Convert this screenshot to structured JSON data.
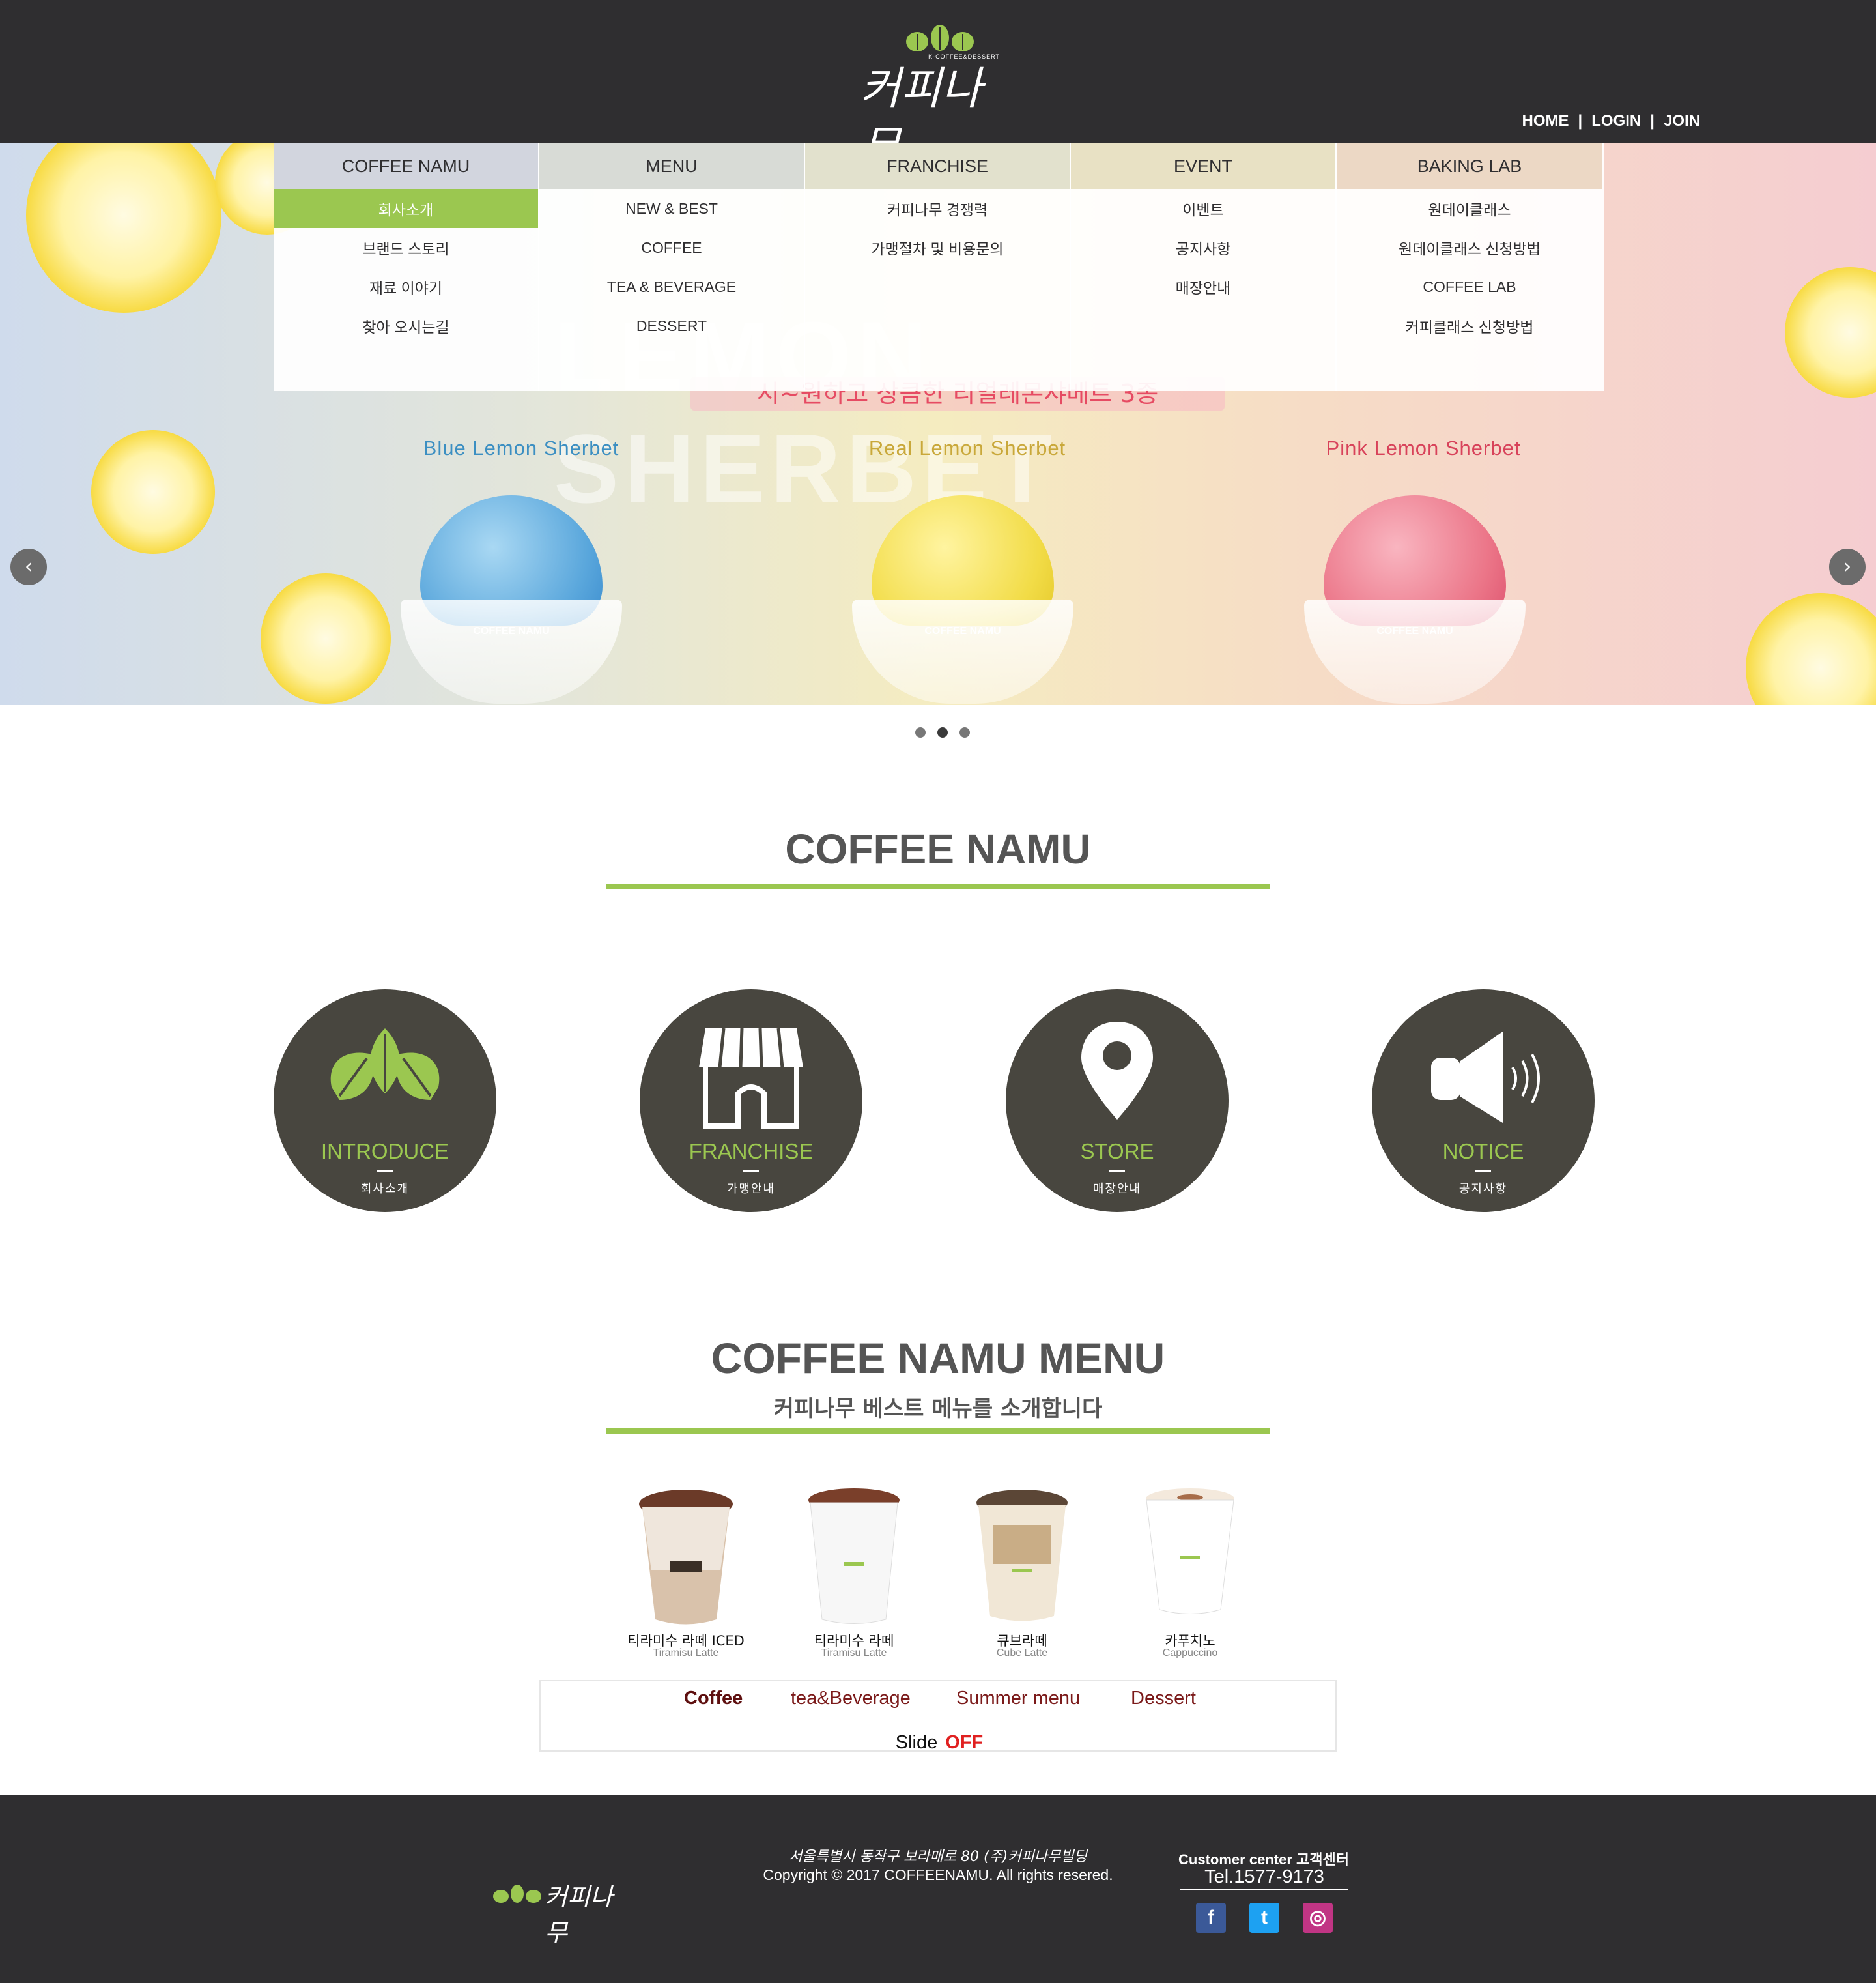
{
  "header": {
    "logo_tagline": "K-COFFEE&DESSERT",
    "logo_text": "커피나무",
    "links": [
      "HOME",
      "LOGIN",
      "JOIN"
    ],
    "separator": "|"
  },
  "nav": {
    "columns": [
      {
        "label": "COFFEE NAMU",
        "items": [
          "회사소개",
          "브랜드 스토리",
          "재료 이야기",
          "찾아 오시는길"
        ]
      },
      {
        "label": "MENU",
        "items": [
          "NEW & BEST",
          "COFFEE",
          "TEA & BEVERAGE",
          "DESSERT"
        ]
      },
      {
        "label": "FRANCHISE",
        "items": [
          "커피나무 경쟁력",
          "가맹절차 및 비용문의"
        ]
      },
      {
        "label": "EVENT",
        "items": [
          "이벤트",
          "공지사항",
          "매장안내"
        ]
      },
      {
        "label": "BAKING LAB",
        "items": [
          "원데이클래스",
          "원데이클래스 신청방법",
          "COFFEE LAB",
          "커피클래스 신청방법"
        ]
      }
    ],
    "active_item": "회사소개"
  },
  "hero": {
    "big_title": "LEMON SHERBET",
    "slogan": "시~원하고 상큼한 리얼레몬샤베트 3종",
    "flavors": [
      {
        "name": "Blue Lemon Sherbet",
        "color": "#3c8fc2"
      },
      {
        "name": "Real Lemon Sherbet",
        "color": "#c9a83a"
      },
      {
        "name": "Pink Lemon Sherbet",
        "color": "#d8425a"
      }
    ],
    "cup_label": "COFFEE NAMU",
    "prev_icon": "chevron-left-icon",
    "next_icon": "chevron-right-icon",
    "prev_glyph": "‹",
    "next_glyph": "›",
    "slide_count": 3,
    "active_slide": 2
  },
  "section_intro": {
    "title": "COFFEE NAMU",
    "circles": [
      {
        "title": "INTRODUCE",
        "sub": "회사소개",
        "icon": "leaves-icon"
      },
      {
        "title": "FRANCHISE",
        "sub": "가맹안내",
        "icon": "storefront-icon"
      },
      {
        "title": "STORE",
        "sub": "매장안내",
        "icon": "map-pin-icon"
      },
      {
        "title": "NOTICE",
        "sub": "공지사항",
        "icon": "megaphone-icon"
      }
    ]
  },
  "section_menu": {
    "title": "COFFEE NAMU MENU",
    "subtitle": "커피나무 베스트 메뉴를 소개합니다",
    "products": [
      {
        "name": "티라미수 라떼 ICED",
        "en": "Tiramisu Latte"
      },
      {
        "name": "티라미수 라떼",
        "en": "Tiramisu Latte"
      },
      {
        "name": "큐브라떼",
        "en": "Cube Latte"
      },
      {
        "name": "카푸치노",
        "en": "Cappuccino"
      }
    ],
    "tabs": [
      "Coffee",
      "tea&Beverage",
      "Summer menu",
      "Dessert"
    ],
    "active_tab": "Coffee",
    "slide_label": "Slide",
    "slide_state": "OFF"
  },
  "footer": {
    "logo_text": "커피나무",
    "address": "서울특별시 동작구 보라매로 80 (주)커피나무빌딩",
    "copyright": "Copyright © 2017 COFFEENAMU. All rights resered.",
    "customer_center": "Customer center 고객센터",
    "tel": "Tel.1577-9173",
    "social": [
      {
        "name": "facebook-icon",
        "glyph": "f",
        "color": "#3b5998"
      },
      {
        "name": "twitter-icon",
        "glyph": "t",
        "color": "#1da1f2"
      },
      {
        "name": "instagram-icon",
        "glyph": "◎",
        "color": "#c13584"
      }
    ]
  },
  "colors": {
    "dark": "#2f2e30",
    "accent_green": "#9bc750",
    "circle_bg": "#48463f",
    "tab_text": "#7b1a1a",
    "off_red": "#e02020"
  }
}
